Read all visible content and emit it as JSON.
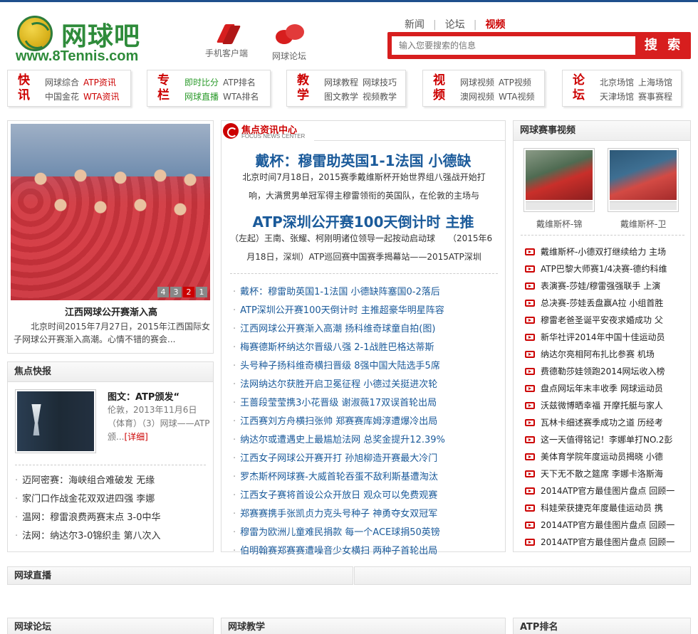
{
  "header": {
    "logo_cn": "网球吧",
    "logo_url": "www.8Tennis.com",
    "mobile_label": "手机客户端",
    "forum_label": "网球论坛",
    "nav": [
      "新闻",
      "论坛",
      "视频"
    ],
    "search_placeholder": "输入您要搜索的信息",
    "search_button": "搜 索"
  },
  "nav_boxes": [
    {
      "tag": "快讯",
      "row1": [
        "网球综合",
        "ATP资讯"
      ],
      "row2": [
        "中国金花",
        "WTA资讯"
      ]
    },
    {
      "tag": "专栏",
      "row1": [
        "即时比分",
        "ATP排名"
      ],
      "row2": [
        "网球直播",
        "WTA排名"
      ]
    },
    {
      "tag": "教学",
      "row1": [
        "网球教程",
        "网球技巧"
      ],
      "row2": [
        "图文教学",
        "视频教学"
      ]
    },
    {
      "tag": "视频",
      "row1": [
        "网球视频",
        "ATP视频"
      ],
      "row2": [
        "澳网视频",
        "WTA视频"
      ]
    },
    {
      "tag": "论坛",
      "row1": [
        "北京场馆",
        "上海场馆"
      ],
      "row2": [
        "天津场馆",
        "赛事赛程"
      ]
    }
  ],
  "left": {
    "pager": [
      "4",
      "3",
      "2",
      "1"
    ],
    "photo_caption": "江西网球公开赛渐入高",
    "photo_desc": "北京时间2015年7月27日，2015年江西国际女子网球公开赛渐入高潮。心情不错的赛会...",
    "flash_title": "焦点快报",
    "flash_item_title": "图文：ATP颁发“",
    "flash_item_desc": "伦敦，2013年11月6日（体育）（3）网球——ATP颁...",
    "flash_more": "[详细]",
    "flash_list": [
      "迈阿密赛：海峡组合难破发 无缘",
      "家门口作战金花双双进四强 李娜",
      "温网：穆雷浪费两赛末点 3-0中华",
      "法网：纳达尔3-0锦织圭 第八次入"
    ]
  },
  "focus": {
    "logo_cn": "焦点资讯中心",
    "logo_en": "FOCUS NEWS CENTER",
    "headline1": "戴杯：穆雷助英国1-1法国 小德缺",
    "desc1a": "北京时间7月18日，2015赛季戴维斯杯开始世界组八强战开始打",
    "desc1b": "响，大满贯男单冠军得主穆雷领衔的英国队，在伦敦的主场与",
    "headline2": "ATP深圳公开赛100天倒计时 主推",
    "desc2a": "（左起）王南、张耀、柯刚明诸位领导一起按动启动球　　（2015年6",
    "desc2b": "月18日，深圳）ATP巡回赛中国赛季揭幕站——2015ATP深圳",
    "list": [
      "戴杯：穆雷助英国1-1法国 小德缺阵塞国0-2落后",
      "ATP深圳公开赛100天倒计时 主推超豪华明星阵容",
      "江西网球公开赛渐入高潮 扬科维奇球童自拍(图)",
      "梅赛德斯杯纳达尔晋级八强 2-1战胜巴格达蒂斯",
      "头号种子扬科维奇横扫晋级 8强中国大陆选手5席",
      "法网纳达尔获胜开启卫冕征程 小德过关挺进次轮",
      "王蔷段莹莹携3小花晋级 谢淑薇17双误首轮出局",
      "江西赛刘方舟横扫张帅 郑赛赛库姆淳遭爆冷出局",
      "纳达尔或遭遇史上最尴尬法网 总奖金提升12.39%",
      "江西女子网球公开赛开打 孙旭柳造开赛最大冷门",
      "罗杰斯杯网球赛-大威首轮吞蛋不敌利斯基遭淘汰",
      "江西女子赛将首设公众开放日 观众可以免费观赛",
      "郑赛赛携手张凯贞力克头号种子 神勇夺女双冠军",
      "穆雷为欧洲儿童难民捐款 每一个ACE球捐50英镑",
      "伯明翰赛郑赛赛遭噪音少女横扫 两种子首轮出局"
    ]
  },
  "video": {
    "title": "网球赛事视频",
    "thumb1": "戴维斯杯-锦",
    "thumb2": "戴维斯杯-卫",
    "list": [
      "戴维斯杯-小德双打继续给力 主场",
      "ATP巴黎大师赛1/4决赛-德约科维",
      "表演赛-莎娃/穆雷强强联手 上演",
      "总决赛-莎娃丢盘赢A拉 小组首胜",
      "穆雷老爸圣诞平安夜求婚成功 父",
      "新华社评2014年中国十佳运动员",
      "纳达尔亮相阿布扎比参赛 机场",
      "费德勒莎娃领跑2014网坛收入榜",
      "盘点网坛年末丰收季 网球运动员",
      "沃兹微博晒幸福 开摩托艇与家人",
      "瓦林卡细述赛季成功之道 历经考",
      "这一天值得铭记！李娜单打NO.2彭",
      "美体育学院年度运动员揭晓 小德",
      "天下无不散之筵席 李娜卡洛斯海",
      "2014ATP官方最佳图片盘点 回顾一",
      "科娃荣获捷克年度最佳运动员 携",
      "2014ATP官方最佳图片盘点 回顾一",
      "2014ATP官方最佳图片盘点 回顾一"
    ]
  },
  "sections": {
    "live": "网球直播",
    "forum": "网球论坛",
    "teaching": "网球教学",
    "atp": "ATP排名"
  },
  "colors": {
    "brand_green": "#2e8b3a",
    "accent_red": "#d71e1e",
    "link_blue": "#1a5a9a"
  }
}
